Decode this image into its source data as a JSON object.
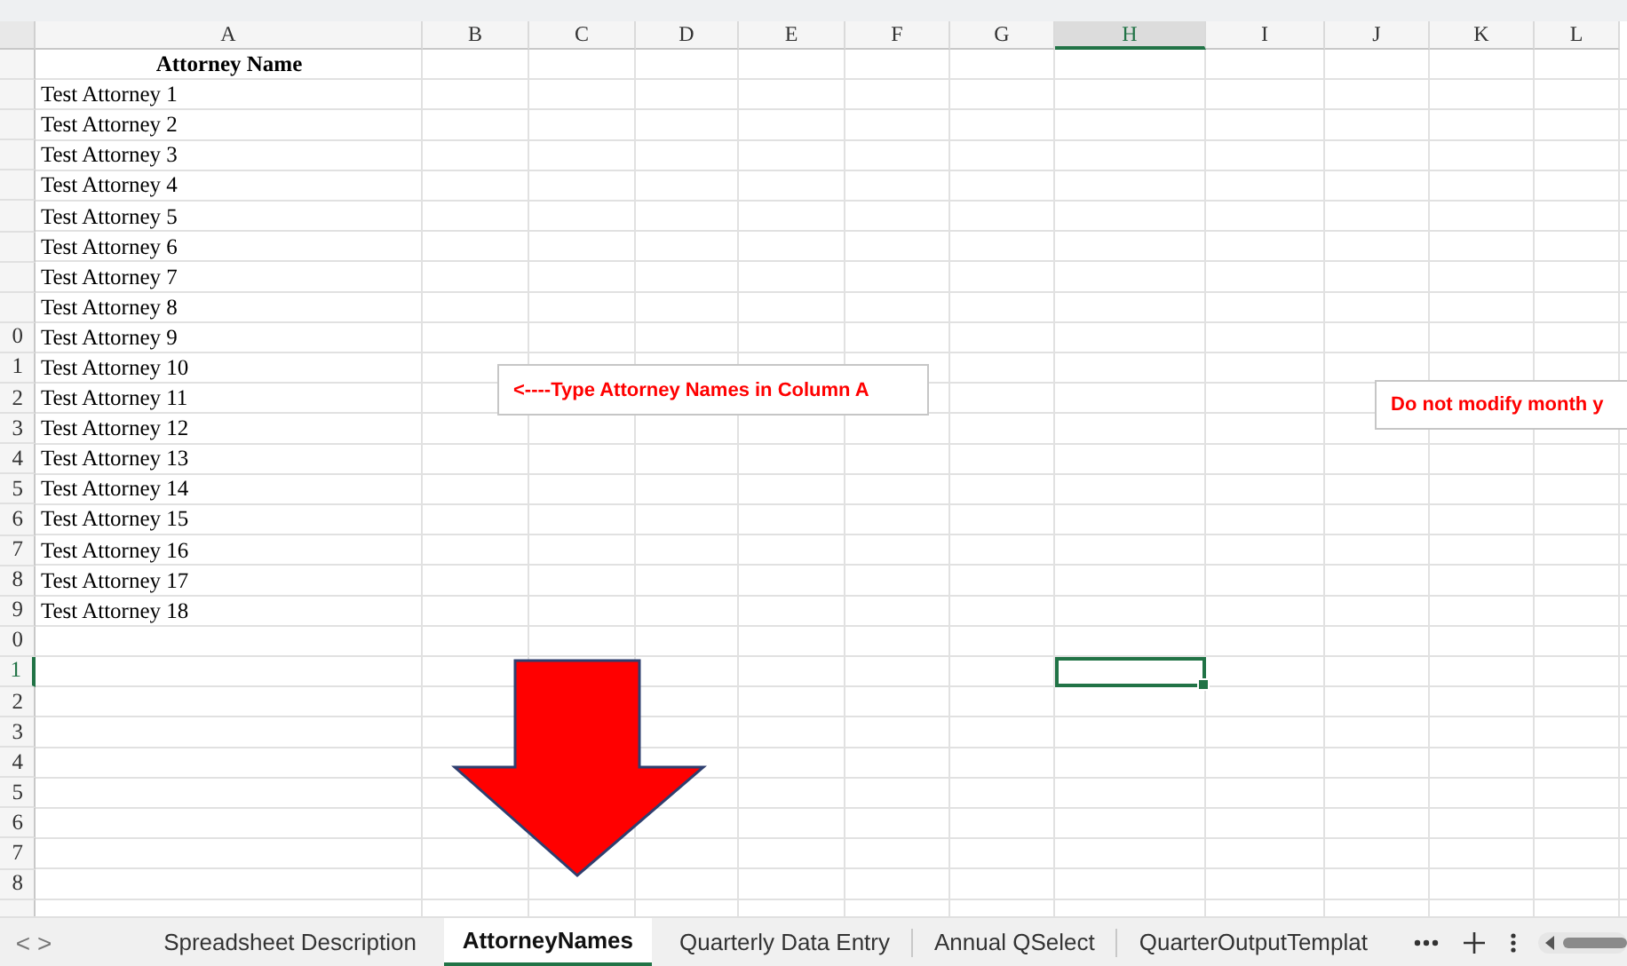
{
  "sheet": {
    "columns": [
      {
        "label": "A",
        "selected": false
      },
      {
        "label": "B",
        "selected": false
      },
      {
        "label": "C",
        "selected": false
      },
      {
        "label": "D",
        "selected": false
      },
      {
        "label": "E",
        "selected": false
      },
      {
        "label": "F",
        "selected": false
      },
      {
        "label": "G",
        "selected": false
      },
      {
        "label": "H",
        "selected": true
      },
      {
        "label": "I",
        "selected": false
      },
      {
        "label": "J",
        "selected": false
      },
      {
        "label": "K",
        "selected": false
      },
      {
        "label": "L",
        "selected": false
      }
    ],
    "rows": [
      {
        "kind": "heading",
        "selected": false,
        "cell": "Attorney Name"
      },
      {
        "kind": "entry",
        "selected": false,
        "cell": "Test Attorney 1"
      },
      {
        "kind": "entry",
        "selected": false,
        "cell": "Test Attorney 2"
      },
      {
        "kind": "entry",
        "selected": false,
        "cell": "Test Attorney 3"
      },
      {
        "kind": "entry",
        "selected": false,
        "cell": "Test Attorney 4"
      },
      {
        "kind": "entry",
        "selected": false,
        "cell": "Test Attorney 5"
      },
      {
        "kind": "entry",
        "selected": false,
        "cell": "Test Attorney 6"
      },
      {
        "kind": "entry",
        "selected": false,
        "cell": "Test Attorney 7"
      },
      {
        "kind": "entry",
        "selected": false,
        "cell": "Test Attorney 8"
      },
      {
        "kind": "entry",
        "selected": false,
        "header": "0",
        "cell": "Test Attorney 9"
      },
      {
        "kind": "entry",
        "selected": false,
        "header": "1",
        "cell": "Test Attorney 10"
      },
      {
        "kind": "entry",
        "selected": false,
        "header": "2",
        "cell": "Test Attorney 11"
      },
      {
        "kind": "entry",
        "selected": false,
        "header": "3",
        "cell": "Test Attorney 12"
      },
      {
        "kind": "entry",
        "selected": false,
        "header": "4",
        "cell": "Test Attorney 13"
      },
      {
        "kind": "entry",
        "selected": false,
        "header": "5",
        "cell": "Test Attorney 14"
      },
      {
        "kind": "entry",
        "selected": false,
        "header": "6",
        "cell": "Test Attorney 15"
      },
      {
        "kind": "entry",
        "selected": false,
        "header": "7",
        "cell": "Test Attorney 16"
      },
      {
        "kind": "entry",
        "selected": false,
        "header": "8",
        "cell": "Test Attorney 17"
      },
      {
        "kind": "entry",
        "selected": false,
        "header": "9",
        "cell": "Test Attorney 18"
      },
      {
        "selected": false,
        "header": "0"
      },
      {
        "selected": true,
        "header": "1"
      },
      {
        "selected": false,
        "header": "2"
      },
      {
        "selected": false,
        "header": "3"
      },
      {
        "selected": false,
        "header": "4"
      },
      {
        "selected": false,
        "header": "5"
      },
      {
        "selected": false,
        "header": "6"
      },
      {
        "selected": false,
        "header": "7"
      },
      {
        "selected": false,
        "header": "8"
      },
      {
        "selected": false
      }
    ]
  },
  "notes": [
    "<----Type Attorney Names in Column A",
    "Do not modify month y"
  ],
  "sheet_tabs": {
    "prev": "<",
    "next": ">",
    "tabs": [
      {
        "label": "Spreadsheet Description",
        "selected": false
      },
      {
        "label": "AttorneyNames",
        "selected": true
      },
      {
        "label": "Quarterly Data Entry",
        "selected": false
      },
      {
        "label": "Annual QSelect",
        "selected": false
      },
      {
        "label": "QuarterOutputTemplat",
        "selected": false
      }
    ]
  }
}
